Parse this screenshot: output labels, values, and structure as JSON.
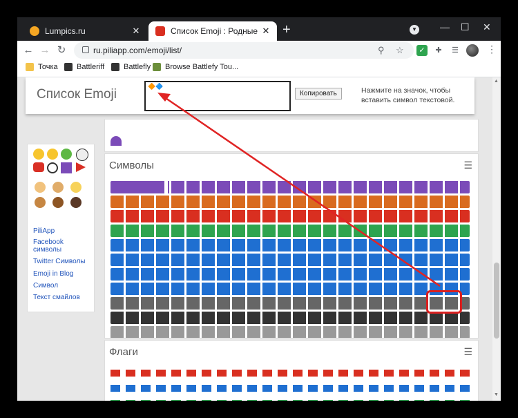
{
  "browser": {
    "tabs": [
      {
        "title": "Lumpics.ru",
        "close": "✕"
      },
      {
        "title": "Список Emoji : Родные символы",
        "close": "✕"
      }
    ],
    "new_tab": "+",
    "url": "ru.piliapp.com/emoji/list/",
    "bookmarks": [
      "Точка",
      "Battleriff",
      "Battlefly",
      "Browse Battlefy Tou..."
    ],
    "colors": {
      "frame": "#202124",
      "tab_active": "#ffffff",
      "toolbar": "#ffffff"
    }
  },
  "page": {
    "title": "Список Emoji",
    "input_value": "🔶🔷",
    "copy_button": "Копировать",
    "hint": "Нажмите на значок, чтобы вставить символ текстовой.",
    "sidebar_links": [
      "PiliApp",
      "Facebook символы",
      "Twitter Символы",
      "Emoji in Blog",
      "Символ",
      "Текст смайлов"
    ],
    "sections": [
      {
        "title": "Символы",
        "menu": "☰"
      },
      {
        "title": "Флаги",
        "menu": "☰"
      }
    ],
    "colors": {
      "highlight": "#d92020",
      "arrow": "#e02424",
      "emoji_blue": "#1f6fd1",
      "emoji_red": "#d92f20"
    }
  }
}
